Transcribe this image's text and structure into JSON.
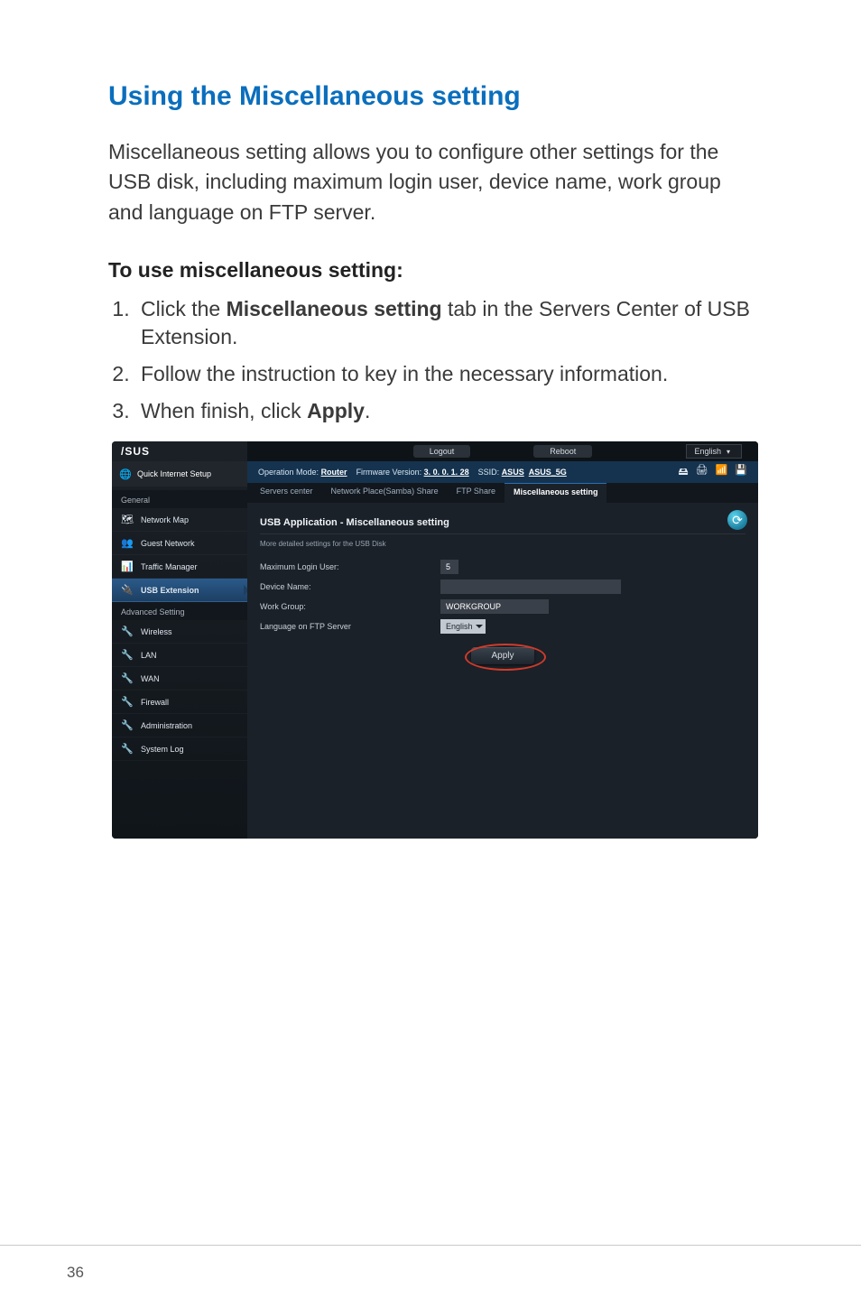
{
  "page": {
    "number": "36"
  },
  "doc": {
    "section_title": "Using the Miscellaneous setting",
    "intro": "Miscellaneous setting allows you to configure other settings for the USB disk, including maximum login user, device name, work group and language on FTP server.",
    "subhead": "To use miscellaneous setting:",
    "steps": {
      "s1_a": "Click the ",
      "s1_b": "Miscellaneous setting",
      "s1_c": " tab in the Servers Center of USB Extension.",
      "s2": "Follow the instruction to key in the necessary information.",
      "s3_a": "When finish, click ",
      "s3_b": "Apply",
      "s3_c": "."
    }
  },
  "ui": {
    "logo": "/SUS",
    "top": {
      "logout": "Logout",
      "reboot": "Reboot",
      "language": "English"
    },
    "infobar": {
      "op_mode_label": "Operation Mode:",
      "op_mode_value": "Router",
      "fw_label": "Firmware Version:",
      "fw_value": "3. 0. 0. 1. 28",
      "ssid_label": "SSID:",
      "ssid_value": "ASUS",
      "ssid_value2": "ASUS_5G"
    },
    "tabs": {
      "t1": "Servers center",
      "t2": "Network Place(Samba) Share",
      "t3": "FTP Share",
      "t4": "Miscellaneous setting"
    },
    "sidebar": {
      "qis": "Quick Internet Setup",
      "group1": "General",
      "items1": {
        "network_map": "Network Map",
        "guest": "Guest Network",
        "traffic": "Traffic Manager",
        "usb": "USB Extension"
      },
      "group2": "Advanced Setting",
      "items2": {
        "wireless": "Wireless",
        "lan": "LAN",
        "wan": "WAN",
        "firewall": "Firewall",
        "admin": "Administration",
        "syslog": "System Log"
      }
    },
    "panel": {
      "title": "USB Application - Miscellaneous setting",
      "sub": "More detailed settings for the USB Disk",
      "rows": {
        "max_login_label": "Maximum Login User:",
        "max_login_value": "5",
        "device_name_label": "Device Name:",
        "device_name_value": "",
        "work_group_label": "Work Group:",
        "work_group_value": "WORKGROUP",
        "ftp_lang_label": "Language on FTP Server",
        "ftp_lang_value": "English"
      },
      "apply": "Apply"
    }
  }
}
